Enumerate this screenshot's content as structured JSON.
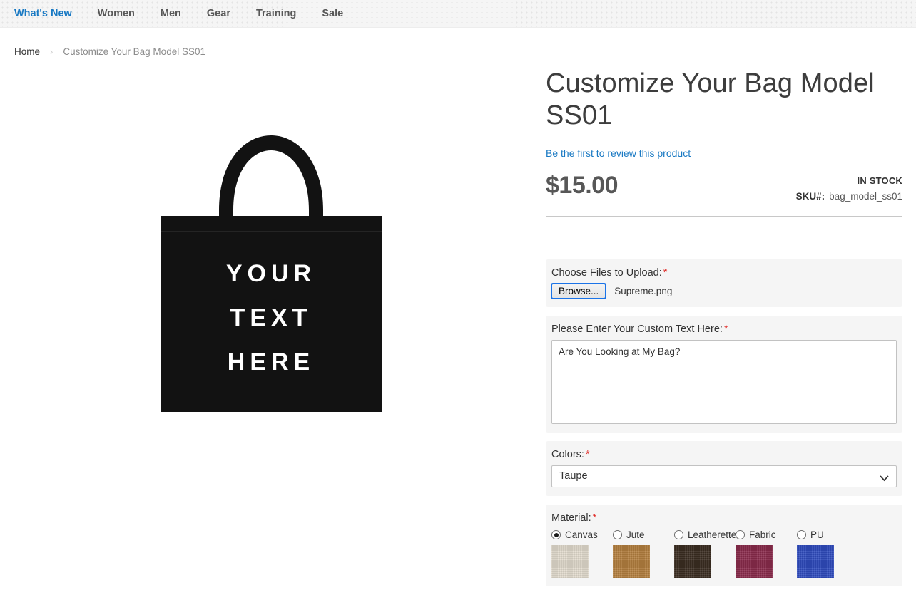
{
  "nav": {
    "items": [
      {
        "label": "What's New",
        "name": "whats-new"
      },
      {
        "label": "Women",
        "name": "women"
      },
      {
        "label": "Men",
        "name": "men"
      },
      {
        "label": "Gear",
        "name": "gear"
      },
      {
        "label": "Training",
        "name": "training"
      },
      {
        "label": "Sale",
        "name": "sale"
      }
    ]
  },
  "breadcrumbs": {
    "home": "Home",
    "separator": "›",
    "current": "Customize Your Bag Model SS01"
  },
  "product": {
    "title": "Customize Your Bag Model SS01",
    "review_link": "Be the first to review this product",
    "price": "$15.00",
    "stock_status": "IN STOCK",
    "sku_label": "SKU#:",
    "sku_value": "bag_model_ss01"
  },
  "gallery": {
    "image_alt": "black-tote-bag-image",
    "print_lines": [
      "YOUR",
      "TEXT",
      "HERE"
    ],
    "bag_color": "#121212",
    "print_color": "#ffffff"
  },
  "options": {
    "upload": {
      "label": "Choose Files to Upload:",
      "required_marker": "*",
      "browse_label": "Browse...",
      "file_name": "Supreme.png"
    },
    "custom_text": {
      "label": "Please Enter Your Custom Text Here:",
      "required_marker": "*",
      "value": "Are You Looking at My Bag?",
      "placeholder": ""
    },
    "colors": {
      "label": "Colors:",
      "required_marker": "*",
      "selected": "Taupe",
      "choices": [
        "Taupe"
      ]
    },
    "material": {
      "label": "Material:",
      "required_marker": "*",
      "selected": "Canvas",
      "choices": [
        {
          "label": "Canvas",
          "swatch": "#e3dccf",
          "checked": true
        },
        {
          "label": "Jute",
          "swatch": "#b4803f",
          "checked": false
        },
        {
          "label": "Leatherette",
          "swatch": "#3b2d22",
          "checked": false
        },
        {
          "label": "Fabric",
          "swatch": "#8a2b4c",
          "checked": false
        },
        {
          "label": "PU",
          "swatch": "#2f4cbe",
          "checked": false
        }
      ]
    }
  },
  "theme": {
    "link_color": "#1979c3",
    "required_color": "#e02b27",
    "option_bg": "#f5f5f5",
    "text_color": "#333333"
  }
}
